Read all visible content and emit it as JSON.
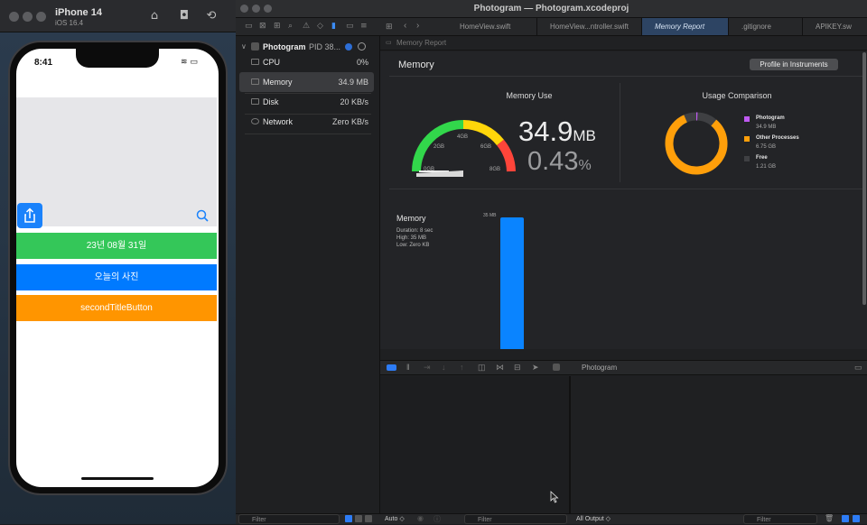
{
  "simulator": {
    "device": "iPhone 14",
    "os": "iOS 16.4",
    "time": "8:41",
    "buttons": [
      {
        "label": "23년 08월 31일",
        "color": "#34c759"
      },
      {
        "label": "오늘의 사진",
        "color": "#007aff"
      },
      {
        "label": "secondTitleButton",
        "color": "#ff9500"
      }
    ]
  },
  "xcode": {
    "window_title": "Photogram — Photogram.xcodeproj",
    "tabs": [
      "HomeView.swift",
      "HomeView...ntroller.swift",
      "Memory Report",
      ".gitignore",
      "APIKEY.sw"
    ],
    "breadcrumb": "Memory Report",
    "navigator": {
      "process": "Photogram",
      "pid": "PID 38...",
      "gauges": [
        {
          "label": "CPU",
          "value": "0%"
        },
        {
          "label": "Memory",
          "value": "34.9 MB"
        },
        {
          "label": "Disk",
          "value": "20 KB/s"
        },
        {
          "label": "Network",
          "value": "Zero KB/s"
        }
      ]
    },
    "report": {
      "title": "Memory",
      "profile_button": "Profile in Instruments",
      "memory_use": {
        "title": "Memory Use",
        "value": "34.9",
        "value_unit": "MB",
        "percent": "0.43",
        "percent_unit": "%",
        "gauge_labels": [
          "0GB",
          "2GB",
          "4GB",
          "6GB",
          "8GB"
        ],
        "fraction": 0.0043
      },
      "usage_comparison": {
        "title": "Usage Comparison",
        "legend": [
          {
            "name": "Photogram",
            "value": "34.9 MB",
            "color": "#bf5af2"
          },
          {
            "name": "Other Processes",
            "value": "6.75 GB",
            "color": "#ff9f0a"
          },
          {
            "name": "Free",
            "value": "1.21 GB",
            "color": "#3f4043"
          }
        ]
      },
      "graph": {
        "title": "Memory",
        "duration": "Duration: 8 sec",
        "high": "High: 35 MB",
        "low": "Low: Zero KB",
        "bar_label": "35 MB"
      }
    },
    "debug": {
      "target": "Photogram",
      "auto_label": "Auto ◇",
      "output_label": "All Output ◇",
      "filter_placeholder": "Filter"
    }
  }
}
